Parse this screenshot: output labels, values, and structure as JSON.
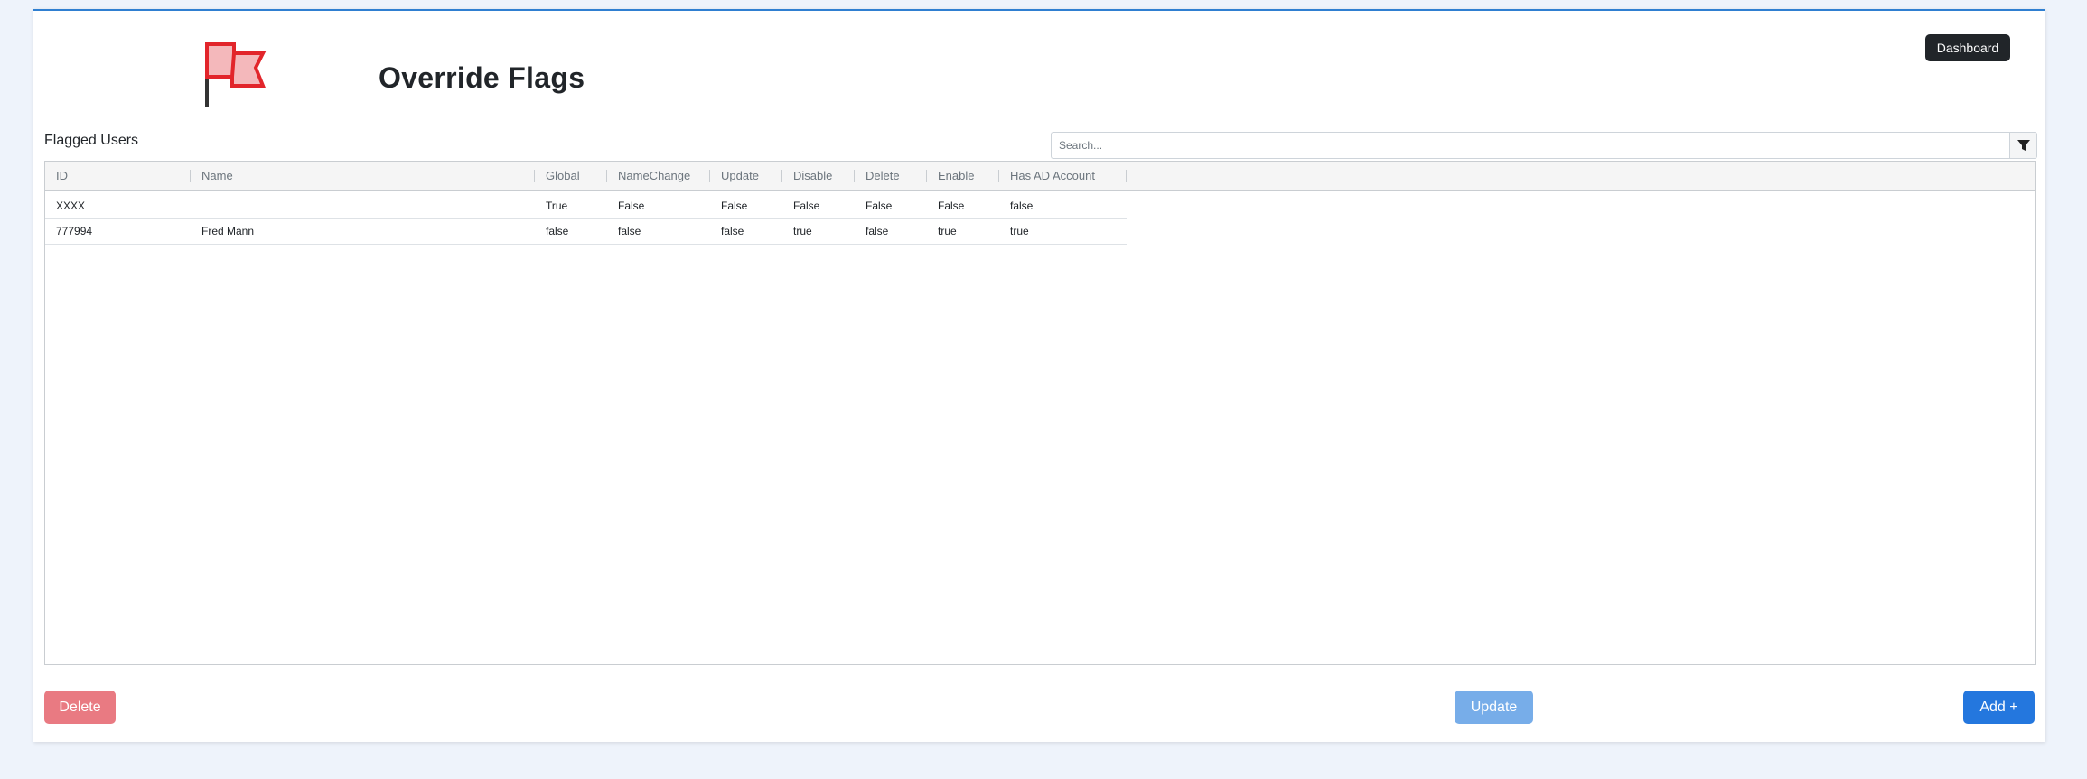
{
  "header": {
    "title": "Override Flags",
    "dashboard_label": "Dashboard"
  },
  "section": {
    "label": "Flagged Users"
  },
  "search": {
    "placeholder": "Search...",
    "value": ""
  },
  "table": {
    "columns": [
      "ID",
      "Name",
      "Global",
      "NameChange",
      "Update",
      "Disable",
      "Delete",
      "Enable",
      "Has AD Account"
    ],
    "rows": [
      {
        "id": "XXXX",
        "name": "",
        "global": "True",
        "namechange": "False",
        "update": "False",
        "disable": "False",
        "delete": "False",
        "enable": "False",
        "ad": "false"
      },
      {
        "id": "777994",
        "name": "Fred Mann",
        "global": "false",
        "namechange": "false",
        "update": "false",
        "disable": "true",
        "delete": "false",
        "enable": "true",
        "ad": "true"
      }
    ]
  },
  "actions": {
    "delete_label": "Delete",
    "update_label": "Update",
    "add_label": "Add +"
  },
  "icons": {
    "logo": "flag-icon",
    "filter": "filter-icon"
  },
  "colors": {
    "accent": "#2477de",
    "danger": "#e97a82",
    "flag_stroke": "#e2252b",
    "flag_fill": "#f4b8bb"
  }
}
